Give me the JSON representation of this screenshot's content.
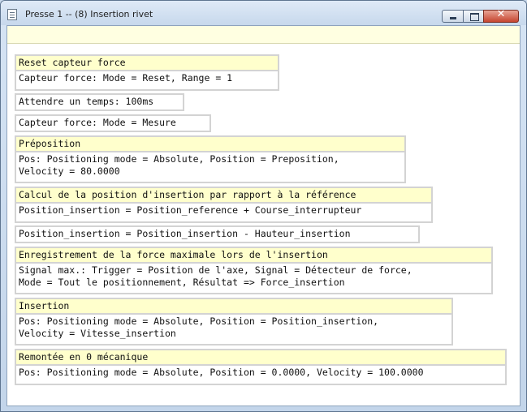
{
  "window": {
    "title": "Presse 1 -- (8) Insertion rivet",
    "icon": "document-icon"
  },
  "steps": [
    {
      "title": "Reset capteur force",
      "body": "Capteur force: Mode = Reset, Range = 1"
    },
    {
      "body": "Attendre un temps: 100ms"
    },
    {
      "body": "Capteur force: Mode = Mesure"
    },
    {
      "title": "Préposition",
      "body": "Pos: Positioning mode = Absolute, Position = Preposition,\nVelocity = 80.0000"
    },
    {
      "title": "Calcul de la position d'insertion par rapport à la référence",
      "body": "Position_insertion = Position_reference + Course_interrupteur"
    },
    {
      "body": "Position_insertion = Position_insertion - Hauteur_insertion"
    },
    {
      "title": "Enregistrement de la force maximale lors de l'insertion",
      "body": "Signal max.: Trigger = Position de l'axe, Signal = Détecteur de force,\nMode = Tout le positionnement, Résultat => Force_insertion"
    },
    {
      "title": "Insertion",
      "body": "Pos: Positioning mode = Absolute, Position = Position_insertion,\nVelocity = Vitesse_insertion"
    },
    {
      "title": "Remontée en 0 mécanique",
      "body": "Pos: Positioning mode = Absolute, Position = 0.0000, Velocity = 100.0000"
    }
  ]
}
